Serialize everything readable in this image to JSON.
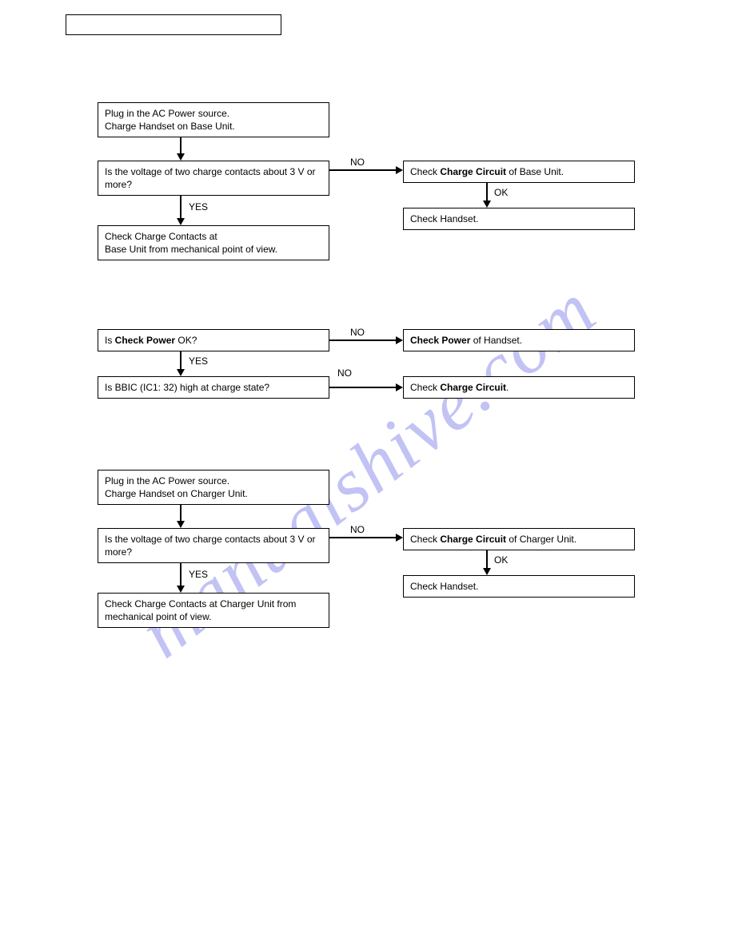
{
  "watermark": "manualshive.com",
  "flow1": {
    "b1": "Plug in the AC Power source.\nCharge Handset on Base Unit.",
    "b2": "Is the voltage of two charge contacts about 3 V or more?",
    "b3": "Check Charge Contacts at\nBase Unit from mechanical point of view.",
    "r1_pre": "Check ",
    "r1_bold": "Charge Circuit",
    "r1_post": " of Base Unit.",
    "r2": "Check Handset.",
    "yes": "YES",
    "no": "NO",
    "ok": "OK"
  },
  "flow2": {
    "q1_pre": "Is ",
    "q1_bold": "Check Power",
    "q1_post": " OK?",
    "q2": "Is BBIC (IC1: 32) high at charge state?",
    "r1_bold": "Check Power",
    "r1_post": " of Handset.",
    "r2_pre": "Check ",
    "r2_bold": "Charge Circuit",
    "r2_post": ".",
    "yes": "YES",
    "no": "NO"
  },
  "flow3": {
    "b1": "Plug in the AC Power source.\nCharge Handset on Charger Unit.",
    "b2": "Is the voltage of two charge contacts about 3 V or more?",
    "b3": "Check Charge Contacts at Charger Unit from mechanical point of view.",
    "r1_pre": "Check ",
    "r1_bold": "Charge Circuit",
    "r1_post": " of Charger Unit.",
    "r2": "Check Handset.",
    "yes": "YES",
    "no": "NO",
    "ok": "OK"
  }
}
